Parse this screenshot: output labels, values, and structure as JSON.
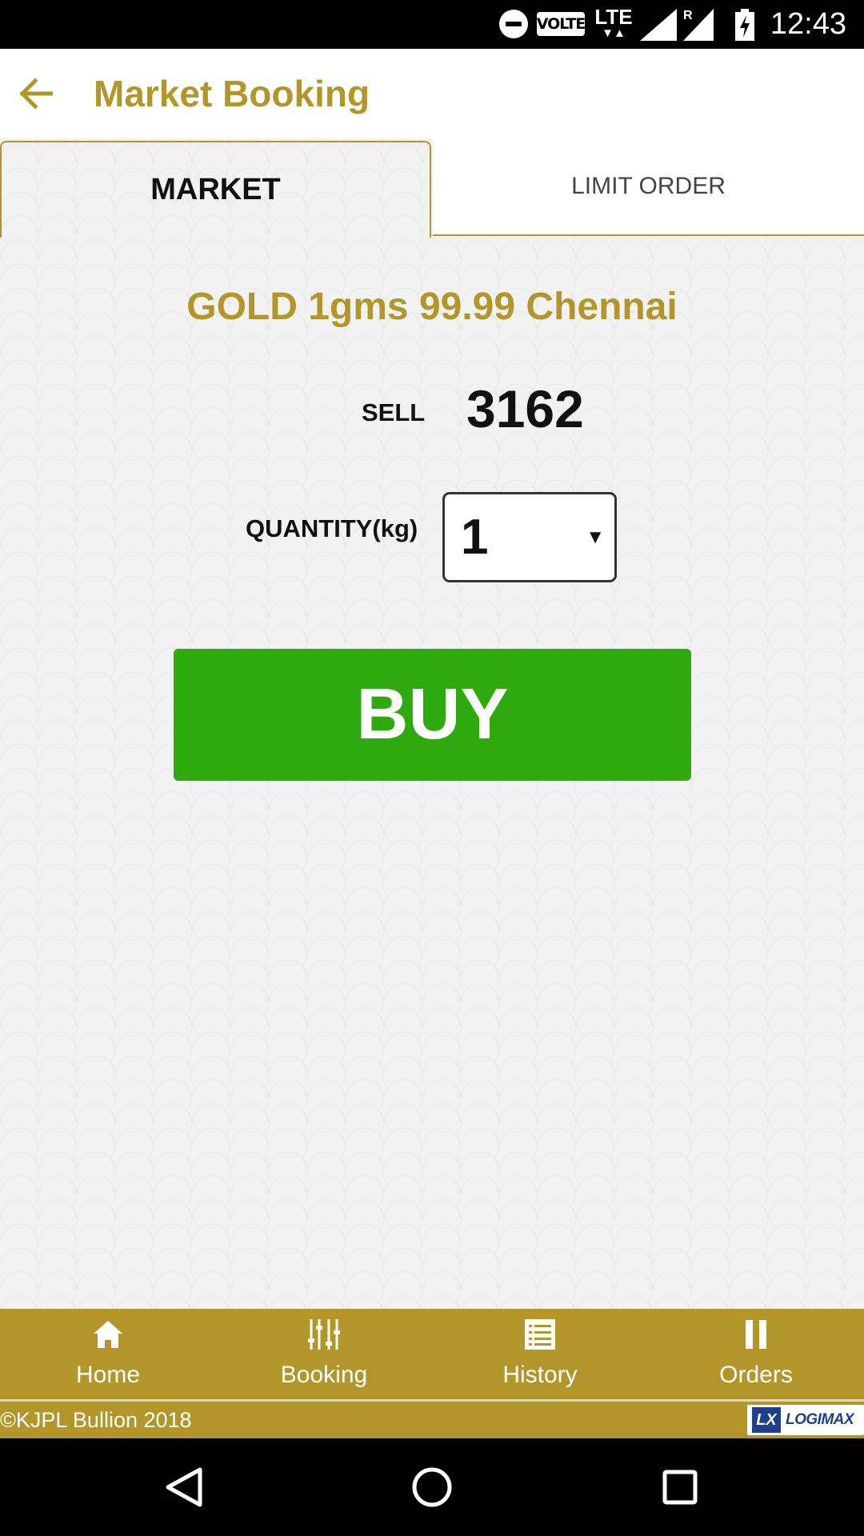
{
  "status_bar": {
    "time": "12:43",
    "network": "LTE",
    "volte": "VOLTE",
    "roaming": "R",
    "icons": [
      "do-not-disturb-icon",
      "volte-icon",
      "lte-icon",
      "signal-icon",
      "roaming-signal-icon",
      "battery-charging-icon"
    ]
  },
  "app_bar": {
    "title": "Market Booking",
    "back_icon": "arrow-left-icon"
  },
  "tabs": [
    {
      "label": "MARKET",
      "selected": true
    },
    {
      "label": "LIMIT ORDER",
      "selected": false
    }
  ],
  "product": {
    "title": "GOLD 1gms 99.99 Chennai",
    "sell_label": "SELL",
    "sell_value": "3162",
    "quantity_label": "QUANTITY(kg)",
    "quantity_value": "1"
  },
  "buy_button": {
    "label": "BUY"
  },
  "bottom_nav": [
    {
      "label": "Home",
      "icon": "home-icon"
    },
    {
      "label": "Booking",
      "icon": "sliders-icon"
    },
    {
      "label": "History",
      "icon": "list-icon"
    },
    {
      "label": "Orders",
      "icon": "pause-icon"
    }
  ],
  "footer": {
    "copyright": "©KJPL Bullion 2018",
    "logo_mark": "LX",
    "logo_text": "LOGIMAX"
  },
  "colors": {
    "brand_gold": "#b3962a",
    "buy_green": "#2eaa0e",
    "background": "#f2f2f2"
  }
}
